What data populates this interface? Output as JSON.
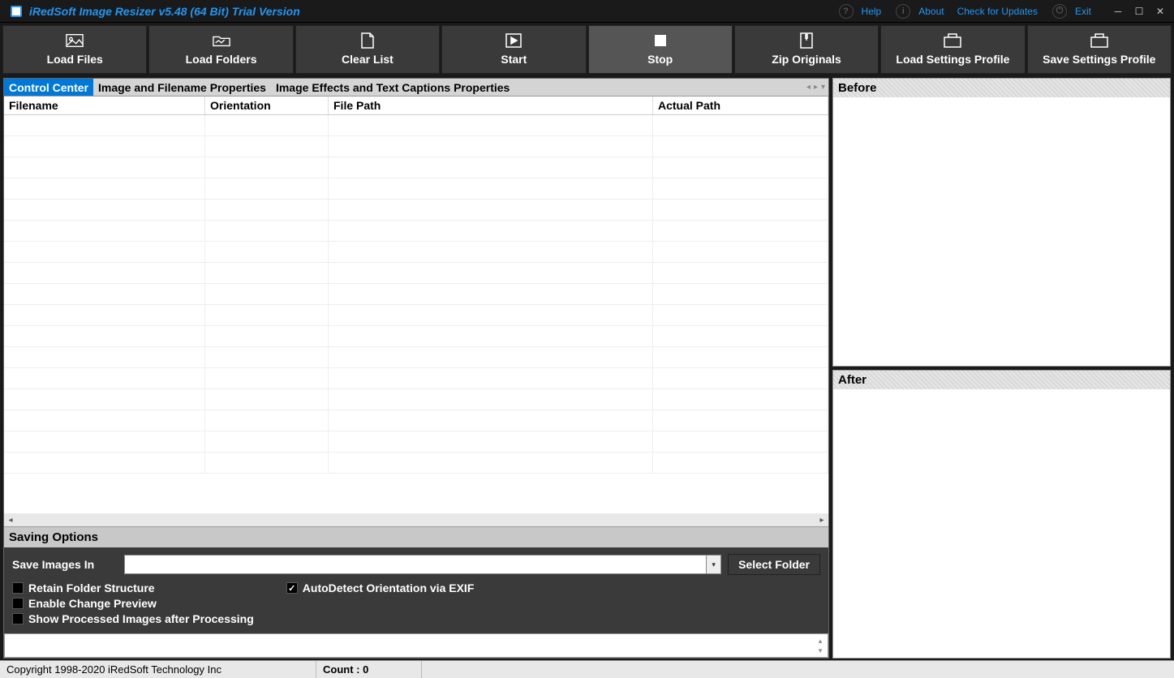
{
  "titlebar": {
    "title": "iRedSoft Image Resizer v5.48 (64 Bit) Trial Version",
    "links": {
      "help": "Help",
      "about": "About",
      "updates": "Check for Updates",
      "exit": "Exit"
    }
  },
  "toolbar": {
    "load_files": "Load Files",
    "load_folders": "Load Folders",
    "clear_list": "Clear List",
    "start": "Start",
    "stop": "Stop",
    "zip_originals": "Zip Originals",
    "load_profile": "Load Settings Profile",
    "save_profile": "Save Settings Profile"
  },
  "tabs": {
    "control_center": "Control Center",
    "image_props": "Image and Filename Properties",
    "effects": "Image Effects and Text Captions Properties"
  },
  "grid": {
    "headers": {
      "filename": "Filename",
      "orientation": "Orientation",
      "filepath": "File Path",
      "actualpath": "Actual Path"
    }
  },
  "saving": {
    "title": "Saving Options",
    "save_in_label": "Save Images In",
    "save_in_value": "",
    "select_folder": "Select Folder",
    "retain": "Retain Folder Structure",
    "enable_preview": "Enable Change Preview",
    "show_processed": "Show Processed Images after Processing",
    "autodetect": "AutoDetect Orientation via EXIF"
  },
  "preview": {
    "before": "Before",
    "after": "After"
  },
  "status": {
    "copyright": "Copyright 1998-2020 iRedSoft Technology Inc",
    "count": "Count : 0"
  }
}
